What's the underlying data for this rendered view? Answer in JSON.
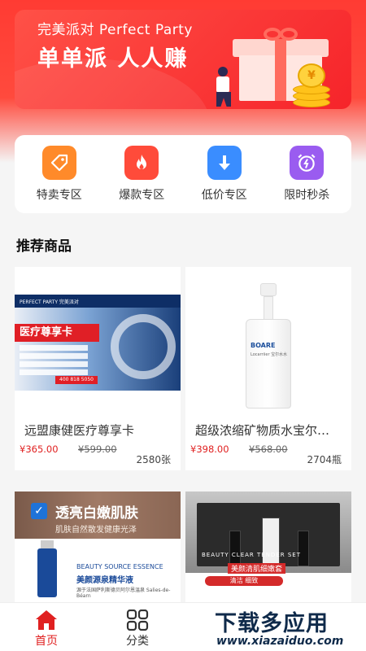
{
  "banner": {
    "title_en": "完美派对 Perfect Party",
    "slogan": "单单派 人人赚",
    "coin_symbol": "¥"
  },
  "categories": [
    {
      "label": "特卖专区",
      "icon": "tag-icon",
      "color": "#ff8a2a"
    },
    {
      "label": "爆款专区",
      "icon": "fire-icon",
      "color": "#ff4b3a"
    },
    {
      "label": "低价专区",
      "icon": "arrow-down-icon",
      "color": "#3a8dff"
    },
    {
      "label": "限时秒杀",
      "icon": "alarm-clock-icon",
      "color": "#9a5cf0"
    }
  ],
  "section": {
    "title": "推荐商品"
  },
  "products": [
    {
      "name": "远盟康健医疗尊享卡",
      "price": "¥365.00",
      "original_price": "¥599.00",
      "sold": "2580张",
      "image": {
        "brand": "PERFECT PARTY 完美派对",
        "tag": "医疗尊享卡",
        "phone": "400 818 5050"
      }
    },
    {
      "name": "超级浓缩矿物质水宝尔…",
      "price": "¥398.00",
      "original_price": "¥568.00",
      "sold": "2704瓶",
      "image": {
        "label": "BOARE",
        "sub": "Locarriier 宝尔水水"
      }
    },
    {
      "image": {
        "title": "透亮白嫩肌肤",
        "subtitle": "肌肤自然散发健康光泽",
        "essence_en": "BEAUTY SOURCE ESSENCE",
        "essence_cn": "美颜源泉精华液",
        "essence_desc": "源于法国萨利斯德贝阿尔恩温泉 Salies-de-Béarn"
      }
    },
    {
      "image": {
        "set_label": "BEAUTY CLEAR TENDER SET",
        "set_cn": "美颜清肌细嫩套",
        "pill": "清洁 细致"
      }
    }
  ],
  "tabbar": {
    "home": {
      "label": "首页",
      "active_color": "#e02020"
    },
    "category": {
      "label": "分类"
    }
  },
  "watermark": {
    "big": "下载多应用",
    "small": "www.xiazaiduo.com"
  },
  "colors": {
    "brand_red": "#f6242a",
    "price_red": "#e02020"
  }
}
